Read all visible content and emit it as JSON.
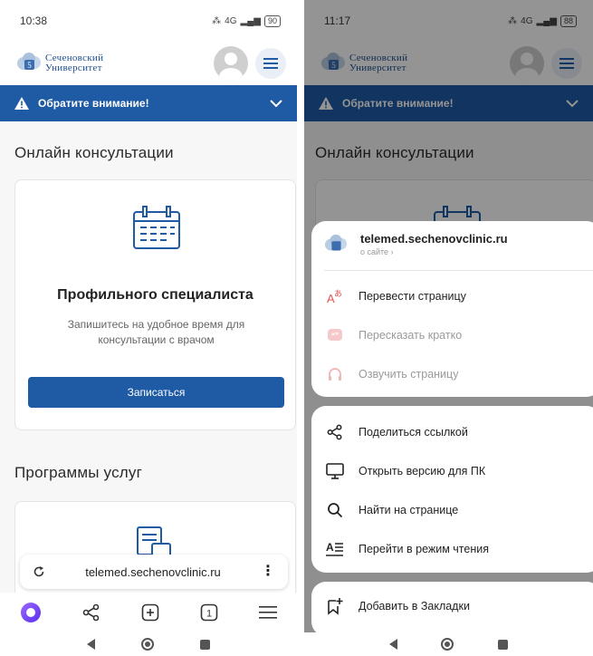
{
  "left": {
    "status": {
      "time": "10:38",
      "network": "4G",
      "battery": "90"
    },
    "logo": {
      "line1": "Сеченовский",
      "line2": "Университет"
    },
    "alert": "Обратите внимание!",
    "section1": "Онлайн консультации",
    "card1": {
      "title": "Профильного специалиста",
      "desc": "Запишитесь на удобное время для консультации с врачом",
      "button": "Записаться"
    },
    "section2": "Программы услуг",
    "urlbar": {
      "url": "telemed.sechenovclinic.ru"
    }
  },
  "right": {
    "status": {
      "time": "11:17",
      "network": "4G",
      "battery": "88"
    },
    "logo": {
      "line1": "Сеченовский",
      "line2": "Университет"
    },
    "alert": "Обратите внимание!",
    "section1": "Онлайн консультации",
    "sheet1": {
      "site": "telemed.sechenovclinic.ru",
      "site_sub": "о сайте ›",
      "items": [
        {
          "label": "Перевести страницу",
          "icon": "translate-icon",
          "enabled": true
        },
        {
          "label": "Пересказать кратко",
          "icon": "summary-icon",
          "enabled": false
        },
        {
          "label": "Озвучить страницу",
          "icon": "headphones-icon",
          "enabled": false
        }
      ]
    },
    "sheet2": {
      "items": [
        {
          "label": "Поделиться ссылкой",
          "icon": "share-icon"
        },
        {
          "label": "Открыть версию для ПК",
          "icon": "desktop-icon"
        },
        {
          "label": "Найти на странице",
          "icon": "search-icon"
        },
        {
          "label": "Перейти в режим чтения",
          "icon": "reader-mode-icon"
        }
      ]
    },
    "sheet3": {
      "items": [
        {
          "label": "Добавить в Закладки",
          "icon": "bookmark-add-icon"
        }
      ]
    }
  },
  "colors": {
    "brand_blue": "#1f5aa5",
    "alice_purple": "#6b3cff"
  }
}
